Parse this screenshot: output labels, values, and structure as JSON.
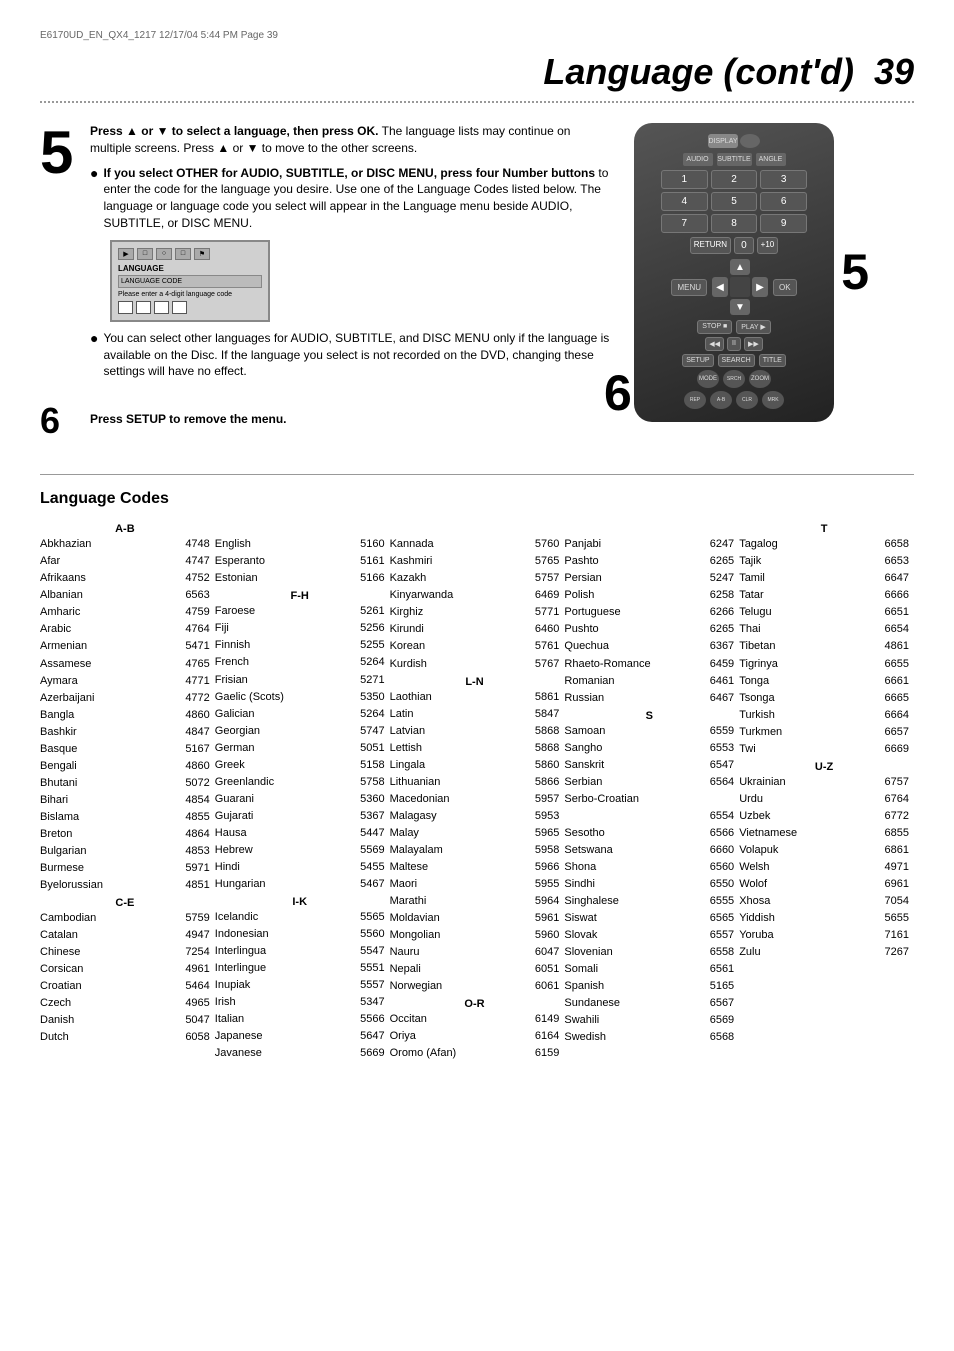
{
  "header": {
    "file_info": "E6170UD_EN_QX4_1217  12/17/04  5:44 PM  Page 39"
  },
  "title": "Language (cont'd)",
  "page_number": "39",
  "step5": {
    "number": "5",
    "text1_bold": "Press ▲ or ▼ to select a language, then press OK.",
    "text1_normal": " The language lists may continue on multiple screens. Press ▲ or ▼ to move to the other screens.",
    "bullet1_bold": "If you select OTHER for AUDIO, SUBTITLE, or DISC MENU, press four Number buttons",
    "bullet1_normal": " to enter the code for the language you desire. Use one of the Language Codes listed below. The language or language code you select will appear in the Language menu beside AUDIO, SUBTITLE, or DISC MENU.",
    "bullet2": "You can select other languages for AUDIO, SUBTITLE, and DISC MENU only if the language is available on the Disc. If the language you select is not recorded on the DVD, changing these settings will have no effect."
  },
  "step6": {
    "number": "6",
    "text": "Press SETUP to remove the menu."
  },
  "lang_codes": {
    "title": "Language Codes",
    "columns": [
      {
        "header": "A-B",
        "entries": [
          {
            "name": "Abkhazian",
            "code": "4748"
          },
          {
            "name": "Afar",
            "code": "4747"
          },
          {
            "name": "Afrikaans",
            "code": "4752"
          },
          {
            "name": "Albanian",
            "code": "6563"
          },
          {
            "name": "Amharic",
            "code": "4759"
          },
          {
            "name": "Arabic",
            "code": "4764"
          },
          {
            "name": "Armenian",
            "code": "5471"
          },
          {
            "name": "Assamese",
            "code": "4765"
          },
          {
            "name": "Aymara",
            "code": "4771"
          },
          {
            "name": "Azerbaijani",
            "code": "4772"
          },
          {
            "name": "Bangla",
            "code": "4860"
          },
          {
            "name": "Bashkir",
            "code": "4847"
          },
          {
            "name": "Basque",
            "code": "5167"
          },
          {
            "name": "Bengali",
            "code": "4860"
          },
          {
            "name": "Bhutani",
            "code": "5072"
          },
          {
            "name": "Bihari",
            "code": "4854"
          },
          {
            "name": "Bislama",
            "code": "4855"
          },
          {
            "name": "Breton",
            "code": "4864"
          },
          {
            "name": "Bulgarian",
            "code": "4853"
          },
          {
            "name": "Burmese",
            "code": "5971"
          },
          {
            "name": "Byelorussian",
            "code": "4851"
          },
          {
            "name": "header_C-E",
            "code": ""
          },
          {
            "name": "Cambodian",
            "code": "5759"
          },
          {
            "name": "Catalan",
            "code": "4947"
          },
          {
            "name": "Chinese",
            "code": "7254"
          },
          {
            "name": "Corsican",
            "code": "4961"
          },
          {
            "name": "Croatian",
            "code": "5464"
          },
          {
            "name": "Czech",
            "code": "4965"
          },
          {
            "name": "Danish",
            "code": "5047"
          },
          {
            "name": "Dutch",
            "code": "6058"
          }
        ]
      },
      {
        "header": "",
        "entries": [
          {
            "name": "English",
            "code": "5160"
          },
          {
            "name": "Esperanto",
            "code": "5161"
          },
          {
            "name": "Estonian",
            "code": "5166"
          },
          {
            "name": "header_F-H",
            "code": ""
          },
          {
            "name": "Faroese",
            "code": "5261"
          },
          {
            "name": "Fiji",
            "code": "5256"
          },
          {
            "name": "Finnish",
            "code": "5255"
          },
          {
            "name": "French",
            "code": "5264"
          },
          {
            "name": "Frisian",
            "code": "5271"
          },
          {
            "name": "Gaelic (Scots)",
            "code": "5350"
          },
          {
            "name": "Galician",
            "code": "5264"
          },
          {
            "name": "Georgian",
            "code": "5747"
          },
          {
            "name": "German",
            "code": "5051"
          },
          {
            "name": "Greek",
            "code": "5158"
          },
          {
            "name": "Greenlandic",
            "code": "5758"
          },
          {
            "name": "Guarani",
            "code": "5360"
          },
          {
            "name": "Gujarati",
            "code": "5367"
          },
          {
            "name": "Hausa",
            "code": "5447"
          },
          {
            "name": "Hebrew",
            "code": "5569"
          },
          {
            "name": "Hindi",
            "code": "5455"
          },
          {
            "name": "Hungarian",
            "code": "5467"
          },
          {
            "name": "header_I-K",
            "code": ""
          },
          {
            "name": "Icelandic",
            "code": "5565"
          },
          {
            "name": "Indonesian",
            "code": "5560"
          },
          {
            "name": "Interlingua",
            "code": "5547"
          },
          {
            "name": "Interlingue",
            "code": "5551"
          },
          {
            "name": "Inupiak",
            "code": "5557"
          },
          {
            "name": "Irish",
            "code": "5347"
          },
          {
            "name": "Italian",
            "code": "5566"
          },
          {
            "name": "Japanese",
            "code": "5647"
          },
          {
            "name": "Javanese",
            "code": "5669"
          }
        ]
      },
      {
        "header": "",
        "entries": [
          {
            "name": "Kannada",
            "code": "5760"
          },
          {
            "name": "Kashmiri",
            "code": "5765"
          },
          {
            "name": "Kazakh",
            "code": "5757"
          },
          {
            "name": "Kinyarwanda",
            "code": "6469"
          },
          {
            "name": "Kirghiz",
            "code": "5771"
          },
          {
            "name": "Kirundi",
            "code": "6460"
          },
          {
            "name": "Korean",
            "code": "5761"
          },
          {
            "name": "Kurdish",
            "code": "5767"
          },
          {
            "name": "header_L-N",
            "code": ""
          },
          {
            "name": "Laothian",
            "code": "5861"
          },
          {
            "name": "Latin",
            "code": "5847"
          },
          {
            "name": "Latvian",
            "code": "5868"
          },
          {
            "name": "Lettish",
            "code": "5868"
          },
          {
            "name": "Lingala",
            "code": "5860"
          },
          {
            "name": "Lithuanian",
            "code": "5866"
          },
          {
            "name": "Macedonian",
            "code": "5957"
          },
          {
            "name": "Malagasy",
            "code": "5953"
          },
          {
            "name": "Malay",
            "code": "5965"
          },
          {
            "name": "Malayalam",
            "code": "5958"
          },
          {
            "name": "Maltese",
            "code": "5966"
          },
          {
            "name": "Maori",
            "code": "5955"
          },
          {
            "name": "Marathi",
            "code": "5964"
          },
          {
            "name": "Moldavian",
            "code": "5961"
          },
          {
            "name": "Mongolian",
            "code": "5960"
          },
          {
            "name": "Nauru",
            "code": "6047"
          },
          {
            "name": "Nepali",
            "code": "6051"
          },
          {
            "name": "Norwegian",
            "code": "6061"
          },
          {
            "name": "header_O-R",
            "code": ""
          },
          {
            "name": "Occitan",
            "code": "6149"
          },
          {
            "name": "Oriya",
            "code": "6164"
          },
          {
            "name": "Oromo (Afan)",
            "code": "6159"
          }
        ]
      },
      {
        "header": "",
        "entries": [
          {
            "name": "Panjabi",
            "code": "6247"
          },
          {
            "name": "Pashto",
            "code": "6265"
          },
          {
            "name": "Persian",
            "code": "5247"
          },
          {
            "name": "Polish",
            "code": "6258"
          },
          {
            "name": "Portuguese",
            "code": "6266"
          },
          {
            "name": "Pushto",
            "code": "6265"
          },
          {
            "name": "Quechua",
            "code": "6367"
          },
          {
            "name": "Rhaeto-Romance",
            "code": "6459"
          },
          {
            "name": "Romanian",
            "code": "6461"
          },
          {
            "name": "Russian",
            "code": "6467"
          },
          {
            "name": "header_S",
            "code": ""
          },
          {
            "name": "Samoan",
            "code": "6559"
          },
          {
            "name": "Sangho",
            "code": "6553"
          },
          {
            "name": "Sanskrit",
            "code": "6547"
          },
          {
            "name": "Serbian",
            "code": "6564"
          },
          {
            "name": "Serbo-Croatian",
            "code": ""
          },
          {
            "name": "",
            "code": "6554"
          },
          {
            "name": "Sesotho",
            "code": "6566"
          },
          {
            "name": "Setswana",
            "code": "6660"
          },
          {
            "name": "Shona",
            "code": "6560"
          },
          {
            "name": "Sindhi",
            "code": "6550"
          },
          {
            "name": "Singhalese",
            "code": "6555"
          },
          {
            "name": "Siswat",
            "code": "6565"
          },
          {
            "name": "Slovak",
            "code": "6557"
          },
          {
            "name": "Slovenian",
            "code": "6558"
          },
          {
            "name": "Somali",
            "code": "6561"
          },
          {
            "name": "Spanish",
            "code": "5165"
          },
          {
            "name": "Sundanese",
            "code": "6567"
          },
          {
            "name": "Swahili",
            "code": "6569"
          },
          {
            "name": "Swedish",
            "code": "6568"
          }
        ]
      },
      {
        "header": "T",
        "entries": [
          {
            "name": "Tagalog",
            "code": "6658"
          },
          {
            "name": "Tajik",
            "code": "6653"
          },
          {
            "name": "Tamil",
            "code": "6647"
          },
          {
            "name": "Tatar",
            "code": "6666"
          },
          {
            "name": "Telugu",
            "code": "6651"
          },
          {
            "name": "Thai",
            "code": "6654"
          },
          {
            "name": "Tibetan",
            "code": "4861"
          },
          {
            "name": "Tigrinya",
            "code": "6655"
          },
          {
            "name": "Tonga",
            "code": "6661"
          },
          {
            "name": "Tsonga",
            "code": "6665"
          },
          {
            "name": "Turkish",
            "code": "6664"
          },
          {
            "name": "Turkmen",
            "code": "6657"
          },
          {
            "name": "Twi",
            "code": "6669"
          },
          {
            "name": "header_U-Z",
            "code": ""
          },
          {
            "name": "Ukrainian",
            "code": "6757"
          },
          {
            "name": "Urdu",
            "code": "6764"
          },
          {
            "name": "Uzbek",
            "code": "6772"
          },
          {
            "name": "Vietnamese",
            "code": "6855"
          },
          {
            "name": "Volapuk",
            "code": "6861"
          },
          {
            "name": "Welsh",
            "code": "4971"
          },
          {
            "name": "Wolof",
            "code": "6961"
          },
          {
            "name": "Xhosa",
            "code": "7054"
          },
          {
            "name": "Yiddish",
            "code": "5655"
          },
          {
            "name": "Yoruba",
            "code": "7161"
          },
          {
            "name": "Zulu",
            "code": "7267"
          }
        ]
      }
    ]
  }
}
